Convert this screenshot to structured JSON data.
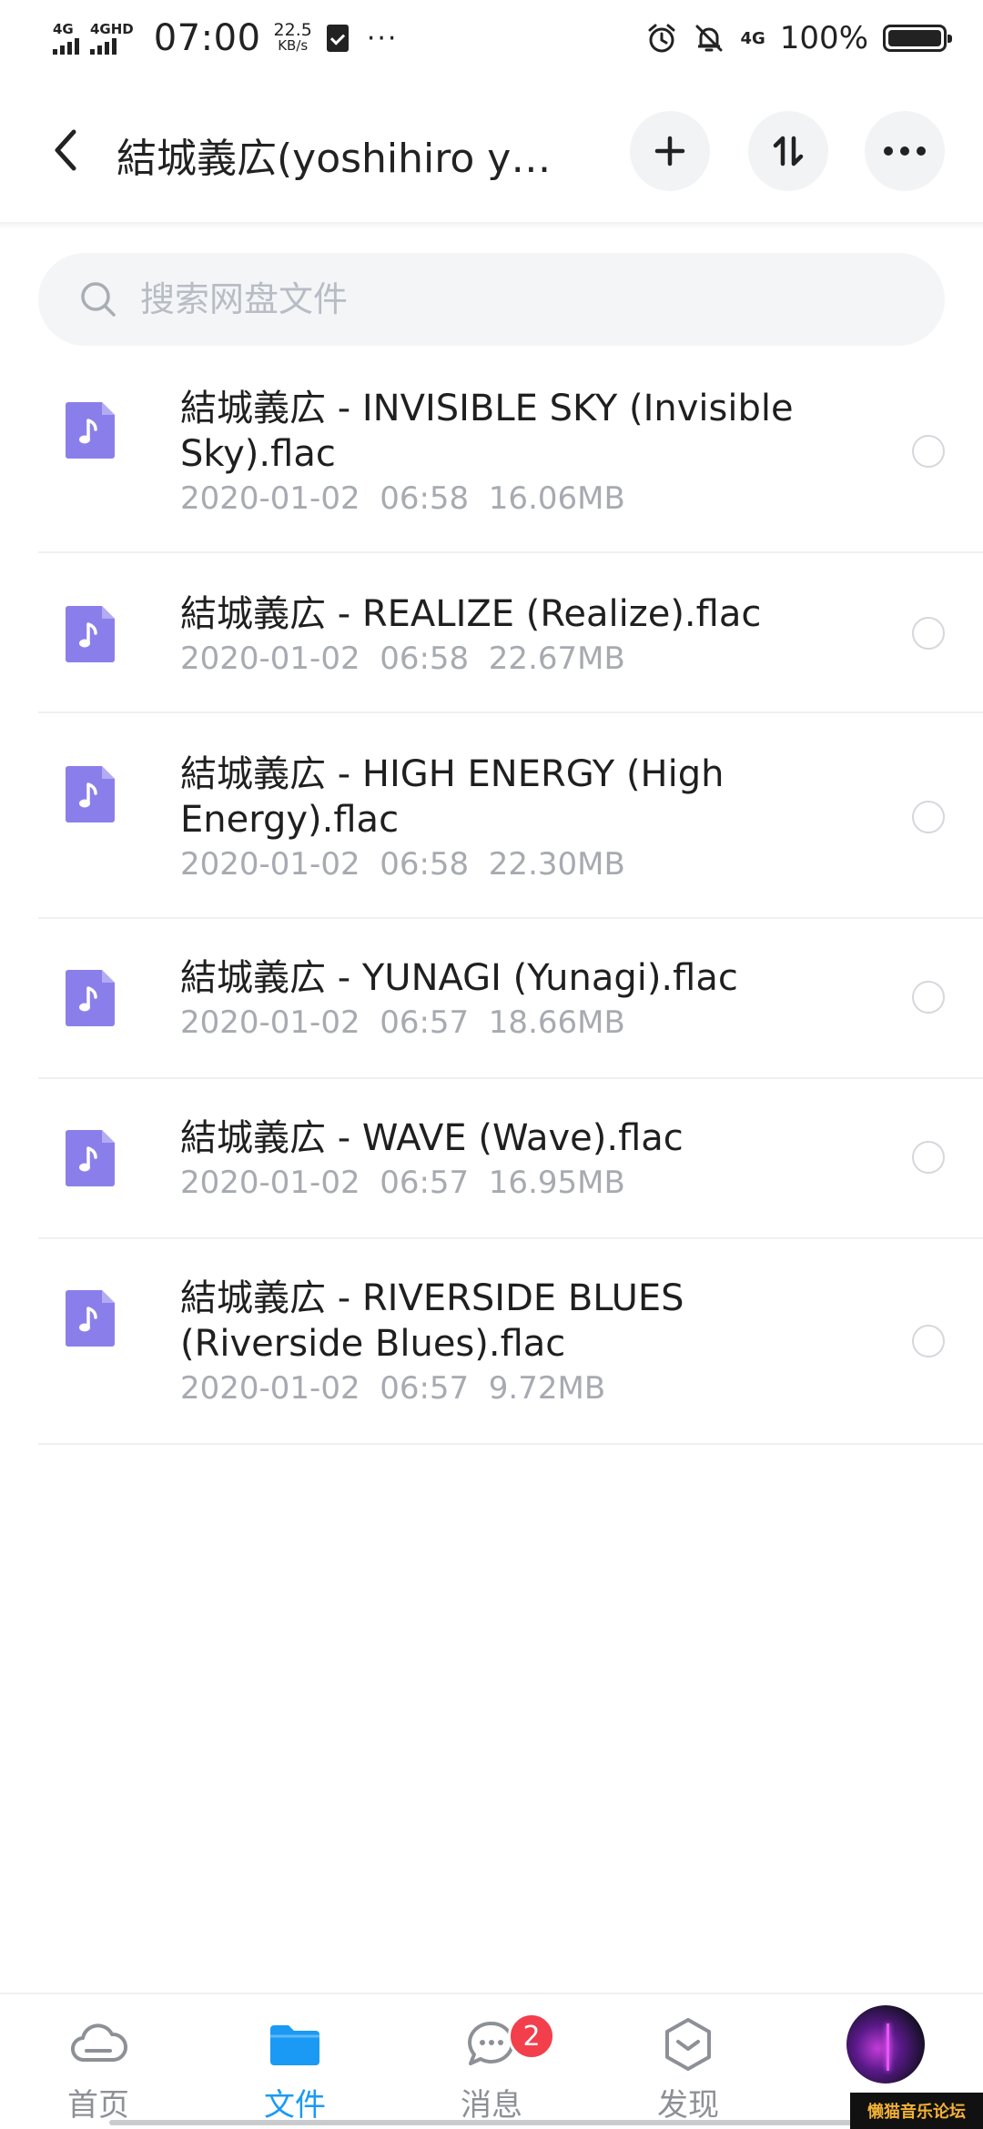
{
  "status_bar": {
    "signal1_label": "4G",
    "signal2_label": "4GHD",
    "time": "07:00",
    "speed_value": "22.5",
    "speed_unit": "KB/s",
    "more": "···",
    "network": "4G",
    "battery_percent": "100%"
  },
  "header": {
    "title": "結城義広(yoshihiro y…",
    "add_icon": "plus-icon",
    "sort_icon": "sort-icon",
    "more_icon": "more-icon"
  },
  "search": {
    "placeholder": "搜索网盘文件"
  },
  "files": [
    {
      "name": "結城義広 - INVISIBLE SKY (Invisible Sky).flac",
      "meta": "2020-01-02  06:58  16.06MB"
    },
    {
      "name": "結城義広 - REALIZE (Realize).flac",
      "meta": "2020-01-02  06:58  22.67MB"
    },
    {
      "name": "結城義広 - HIGH ENERGY (High Energy).flac",
      "meta": "2020-01-02  06:58  22.30MB"
    },
    {
      "name": "結城義広 - YUNAGI (Yunagi).flac",
      "meta": "2020-01-02  06:57  18.66MB"
    },
    {
      "name": "結城義広 - WAVE (Wave).flac",
      "meta": "2020-01-02  06:57  16.95MB"
    },
    {
      "name": "結城義広 - RIVERSIDE BLUES (Riverside Blues).flac",
      "meta": "2020-01-02  06:57  9.72MB"
    }
  ],
  "bottom_nav": {
    "home": "首页",
    "files": "文件",
    "messages": "消息",
    "messages_badge": "2",
    "discover": "发现"
  },
  "watermark": "懒猫音乐论坛",
  "colors": {
    "accent": "#1a9af5",
    "music_icon": "#8a7fea",
    "badge": "#f23f4b"
  }
}
